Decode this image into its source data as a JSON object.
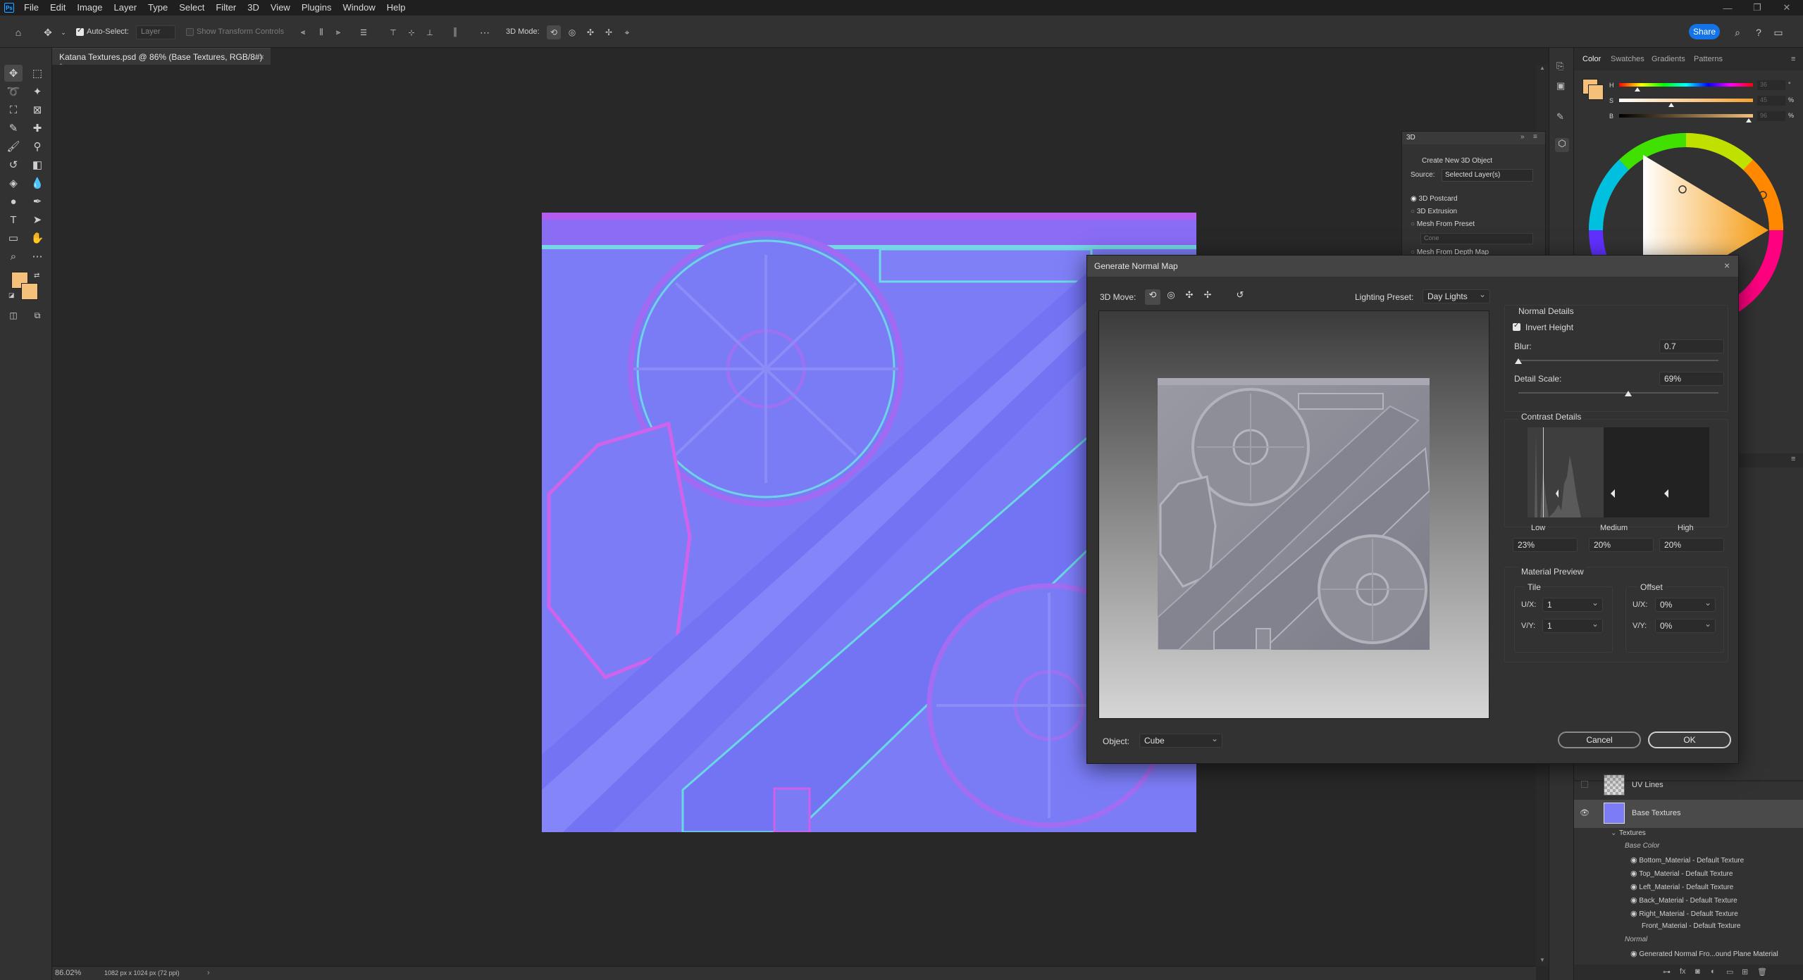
{
  "app": {
    "menu": [
      "File",
      "Edit",
      "Image",
      "Layer",
      "Type",
      "Select",
      "Filter",
      "3D",
      "View",
      "Plugins",
      "Window",
      "Help"
    ],
    "window_controls": [
      "—",
      "❐",
      "✕"
    ]
  },
  "options_bar": {
    "auto_select_label": "Auto-Select:",
    "auto_select_value": "Layer",
    "transform_controls_label": "Show Transform Controls",
    "mode_label": "3D Mode:",
    "share_label": "Share"
  },
  "document": {
    "tab_title": "Katana Textures.psd @ 86% (Base Textures, RGB/8#) *",
    "zoom": "86.02%",
    "doc_info": "1082 px x 1024 px (72 ppi)"
  },
  "panel_3d": {
    "title": "3D",
    "create_label": "Create New 3D Object",
    "source_label": "Source:",
    "source_value": "Selected Layer(s)",
    "options": [
      "3D Postcard",
      "3D Extrusion",
      "Mesh From Preset",
      "Mesh From Depth Map"
    ],
    "preset_value": "Cone"
  },
  "color_panel": {
    "tabs": [
      "Color",
      "Swatches",
      "Gradients",
      "Patterns"
    ],
    "sliders": [
      {
        "letter": "H",
        "value": "36",
        "unit": "°"
      },
      {
        "letter": "S",
        "value": "45",
        "unit": "%"
      },
      {
        "letter": "B",
        "value": "96",
        "unit": "%"
      }
    ],
    "foreground": "#f5c07a",
    "background": "#f5c07a"
  },
  "dialog": {
    "title": "Generate Normal Map",
    "move_label": "3D Move:",
    "lighting_label": "Lighting Preset:",
    "lighting_value": "Day Lights",
    "normal_details_title": "Normal Details",
    "invert_height_label": "Invert Height",
    "invert_height_checked": true,
    "blur_label": "Blur:",
    "blur_value": "0.7",
    "blur_fraction": 0.0,
    "detail_scale_label": "Detail Scale:",
    "detail_scale_value": "69%",
    "detail_scale_fraction": 0.55,
    "contrast_title": "Contrast Details",
    "contrast_labels": [
      "Low",
      "Medium",
      "High"
    ],
    "contrast_values": [
      "23%",
      "20%",
      "20%"
    ],
    "material_title": "Material Preview",
    "tile_title": "Tile",
    "offset_title": "Offset",
    "tile_ux_label": "U/X:",
    "tile_ux_value": "1",
    "tile_vy_label": "V/Y:",
    "tile_vy_value": "1",
    "offset_ux_label": "U/X:",
    "offset_ux_value": "0%",
    "offset_vy_label": "V/Y:",
    "offset_vy_value": "0%",
    "object_label": "Object:",
    "object_value": "Cube",
    "cancel_label": "Cancel",
    "ok_label": "OK"
  },
  "layers": {
    "rows": [
      {
        "name": "UV Lines"
      },
      {
        "name": "Base Textures"
      }
    ],
    "textures_label": "Textures",
    "base_color_label": "Base Color",
    "materials": [
      "Bottom_Material - Default Texture",
      "Top_Material - Default Texture",
      "Left_Material - Default Texture",
      "Back_Material - Default Texture",
      "Right_Material - Default Texture",
      "Front_Material - Default Texture"
    ],
    "normal_label": "Normal",
    "normal_item": "Generated Normal Fro...ound Plane Material"
  }
}
